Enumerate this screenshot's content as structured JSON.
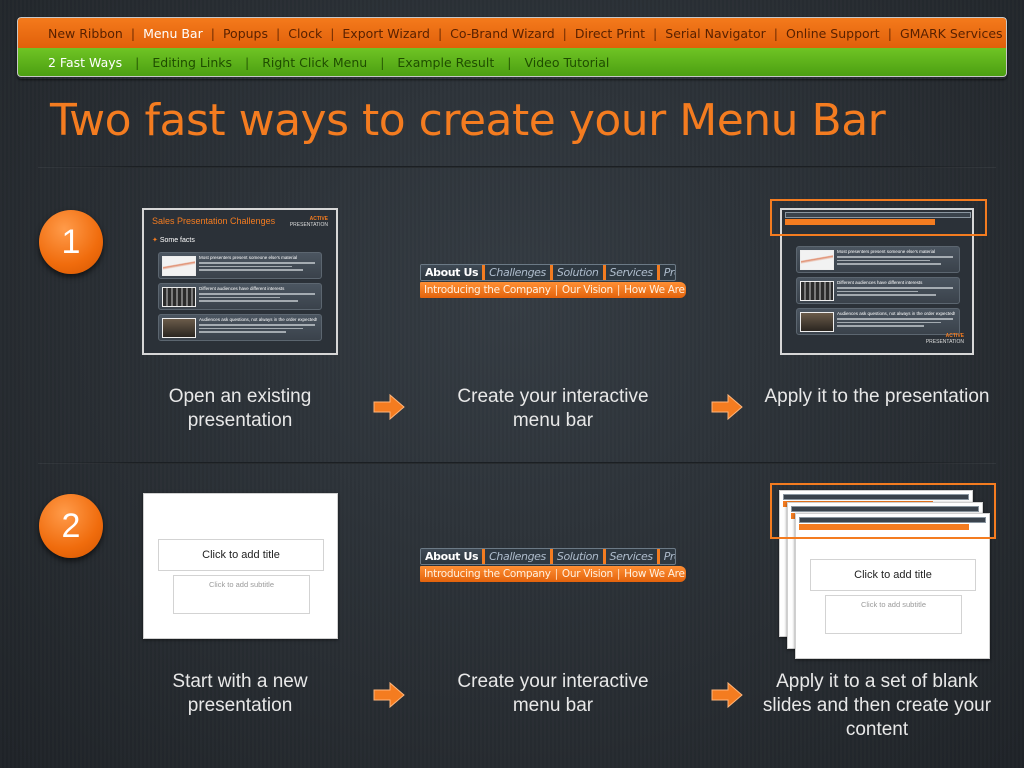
{
  "nav": {
    "primary": [
      {
        "label": "New Ribbon",
        "active": false
      },
      {
        "label": "Menu Bar",
        "active": true
      },
      {
        "label": "Popups",
        "active": false
      },
      {
        "label": "Clock",
        "active": false
      },
      {
        "label": "Export Wizard",
        "active": false
      },
      {
        "label": "Co-Brand Wizard",
        "active": false
      },
      {
        "label": "Direct Print",
        "active": false
      },
      {
        "label": "Serial Navigator",
        "active": false
      },
      {
        "label": "Online Support",
        "active": false
      },
      {
        "label": "GMARK Services",
        "active": false
      }
    ],
    "secondary": [
      {
        "label": "2 Fast Ways",
        "active": true
      },
      {
        "label": "Editing Links",
        "active": false
      },
      {
        "label": "Right Click Menu",
        "active": false
      },
      {
        "label": "Example Result",
        "active": false
      },
      {
        "label": "Video Tutorial",
        "active": false
      }
    ],
    "separator": "|"
  },
  "title": "Two fast ways to create your Menu Bar",
  "steps": [
    {
      "number": "1",
      "captions": [
        "Open an existing presentation",
        "Create your interactive menu bar",
        "Apply it to the presentation"
      ]
    },
    {
      "number": "2",
      "captions": [
        "Start with a new presentation",
        "Create your interactive menu bar",
        "Apply it to a set of blank slides and then create your content"
      ]
    }
  ],
  "sample_slide": {
    "title": "Sales Presentation Challenges",
    "logo_line1": "ACTIVE",
    "logo_line2": "PRESENTATION",
    "subtitle": "Some facts",
    "items": [
      "Most presenters present someone else's material",
      "Different audiences have different interests",
      "Audiences ask questions, not always in the order expected!"
    ]
  },
  "blank_slide": {
    "title_placeholder": "Click to add title",
    "subtitle_placeholder": "Click to add subtitle"
  },
  "menu_preview": {
    "tabs": [
      "About Us",
      "Challenges",
      "Solution",
      "Services",
      "Prod"
    ],
    "sub_items": [
      "Introducing the Company",
      "Our Vision",
      "How We Are Dif"
    ]
  },
  "colors": {
    "accent": "#f47c20",
    "nav_green": "#5cb21a",
    "background": "#2a3036"
  },
  "icons": [
    "arrow-right-icon"
  ]
}
